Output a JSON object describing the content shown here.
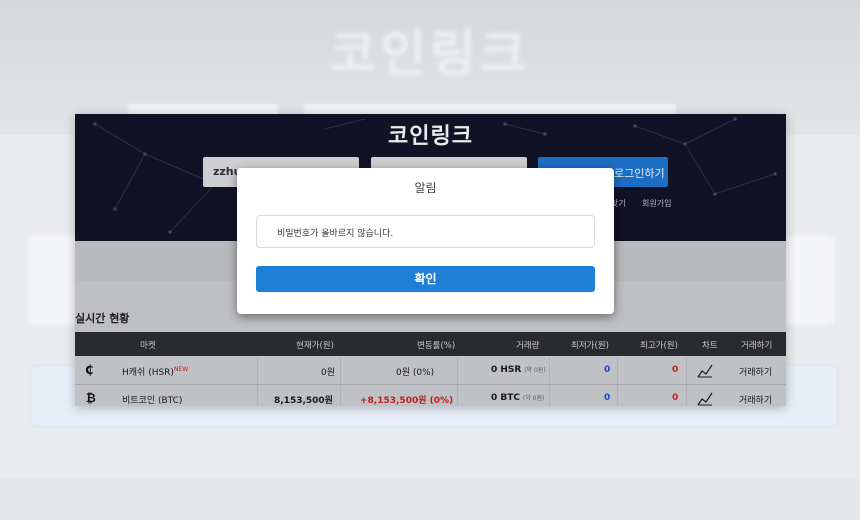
{
  "site": {
    "title": "코인링크"
  },
  "login": {
    "id_value": "zzhu",
    "button_label": "로그인하기",
    "find_link": "찾기",
    "join_link": "회원가입"
  },
  "section": {
    "title": "실시간 현황"
  },
  "table": {
    "headers": [
      "마켓",
      "현재가(원)",
      "변동률(%)",
      "거래량",
      "최저가(원)",
      "최고가(원)",
      "차트",
      "거래하기"
    ],
    "rows": [
      {
        "icon": "hsr-coin-icon",
        "icon_glyph": "₵",
        "market": "H캐쉬 (HSR)",
        "badge": "NEW",
        "price": "0원",
        "change": "0원 (0%)",
        "volume": "0 HSR",
        "volume_sub": "(약 0원)",
        "low": "0",
        "high": "0",
        "trade": "거래하기"
      },
      {
        "icon": "bitcoin-icon",
        "icon_glyph": "₿",
        "market": "비트코인 (BTC)",
        "badge": "",
        "price": "8,153,500원",
        "change": "+8,153,500원 (0%)",
        "volume": "0 BTC",
        "volume_sub": "(약 0원)",
        "low": "0",
        "high": "0",
        "trade": "거래하기"
      }
    ]
  },
  "dialog": {
    "title": "알림",
    "message": "비밀번호가 올바르지 않습니다.",
    "confirm_label": "확인"
  },
  "colors": {
    "hero_bg": "#14142a",
    "accent_blue": "#1e7fd6",
    "price_up_red": "#d42020",
    "value_blue": "#1a4fd8"
  }
}
